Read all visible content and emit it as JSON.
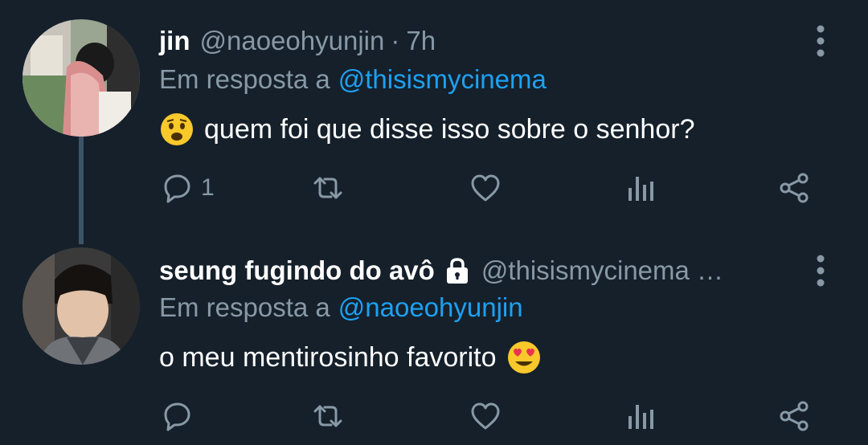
{
  "colors": {
    "background": "#15202b",
    "secondary_text": "#8899a6",
    "link": "#1da1f2",
    "thread_line": "#3d5466"
  },
  "tweets": [
    {
      "name": "jin",
      "handle": "@naoeohyunjin",
      "separator": "·",
      "time": "7h",
      "reply_prefix": "Em resposta a",
      "reply_to": "@thisismycinema",
      "text": "quem foi que disse isso sobre o senhor?",
      "leading_emoji": "frowning-face-emoji",
      "actions": {
        "reply_count": "1",
        "retweet_count": "",
        "like_count": ""
      }
    },
    {
      "name": "seung fugindo do avô",
      "protected_icon": "lock-icon",
      "handle": "@thisismycinema …",
      "reply_prefix": "Em resposta a",
      "reply_to": "@naoeohyunjin",
      "text": "o meu mentirosinho favorito",
      "trailing_emoji": "heart-eyes-emoji",
      "actions": {
        "reply_count": "",
        "retweet_count": "",
        "like_count": ""
      }
    }
  ]
}
